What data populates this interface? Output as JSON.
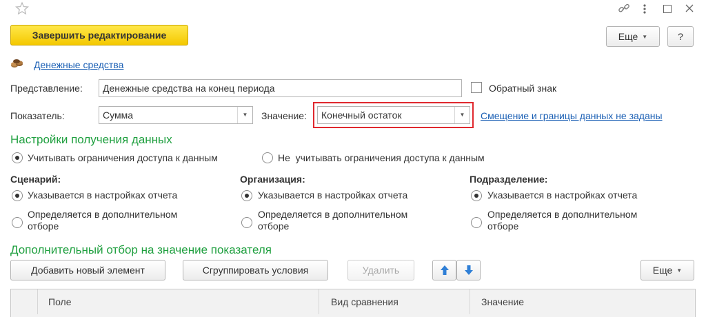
{
  "window_controls": {
    "favorite_icon": "star-outline-icon",
    "link_icon": "chain-link-icon",
    "menu_icon": "vertical-ellipsis-icon",
    "maximize_icon": "square-icon",
    "close_icon": "close-icon"
  },
  "toolbar": {
    "finish_label": "Завершить редактирование",
    "more_label": "Еще",
    "help_label": "?"
  },
  "source_link": "Денежные средства",
  "representation": {
    "label": "Представление:",
    "value": "Денежные средства на конец периода",
    "inverse_label": "Обратный знак"
  },
  "indicator": {
    "label": "Показатель:",
    "value": "Сумма",
    "value_label": "Значение:",
    "value_value": "Конечный остаток",
    "offset_link": "Смещение и границы данных не заданы"
  },
  "data_settings": {
    "title": "Настройки получения данных",
    "access_on": "Учитывать ограничения доступа к данным",
    "access_off": "Не  учитывать ограничения доступа к данным"
  },
  "groups": [
    {
      "title": "Сценарий:",
      "opt1": "Указывается в настройках отчета",
      "opt2a": "Определяется в дополнительном",
      "opt2b": "отборе"
    },
    {
      "title": "Организация:",
      "opt1": "Указывается в настройках отчета",
      "opt2a": "Определяется в дополнительном",
      "opt2b": "отборе"
    },
    {
      "title": "Подразделение:",
      "opt1": "Указывается в настройках отчета",
      "opt2a": "Определяется в дополнительном",
      "opt2b": "отборе"
    }
  ],
  "filter": {
    "title": "Дополнительный отбор на значение показателя",
    "add_label": "Добавить новый элемент",
    "group_label": "Сгруппировать условия",
    "delete_label": "Удалить",
    "more_label": "Еще",
    "columns": [
      "Поле",
      "Вид сравнения",
      "Значение"
    ]
  },
  "colors": {
    "accent_yellow": "#f4c800",
    "section_green": "#20a040",
    "link_blue": "#1a5fb4",
    "highlight_red": "#e0282e",
    "arrow_blue": "#2f7fd6"
  }
}
